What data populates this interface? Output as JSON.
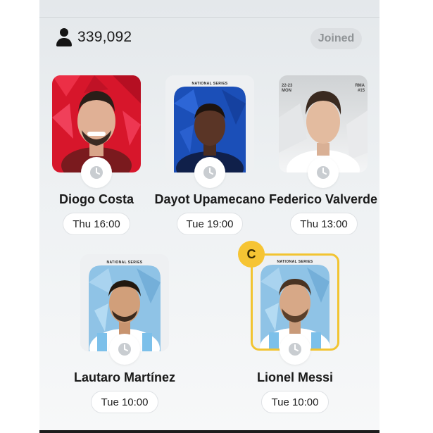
{
  "league": {
    "participant_count": "339,092",
    "status_badge": "Joined"
  },
  "cards": [
    {
      "name": "Diogo Costa",
      "time": "Thu 16:00",
      "series_label": "",
      "corner_left": "",
      "corner_right": ""
    },
    {
      "name": "Dayot Upamecano",
      "time": "Tue 19:00",
      "series_label": "NATIONAL SERIES",
      "corner_left": "",
      "corner_right": ""
    },
    {
      "name": "Federico Valverde",
      "time": "Thu 13:00",
      "series_label": "",
      "corner_left": "22-23 MON",
      "corner_right": "RMA #15"
    },
    {
      "name": "Lautaro Martínez",
      "time": "Tue 10:00",
      "series_label": "NATIONAL SERIES",
      "corner_left": "",
      "corner_right": ""
    },
    {
      "name": "Lionel Messi",
      "time": "Tue 10:00",
      "series_label": "NATIONAL SERIES",
      "corner_left": "",
      "corner_right": "",
      "captain": "C"
    }
  ],
  "icons": {
    "participants": "person-icon",
    "lineup_status": "clock-icon"
  },
  "colors": {
    "captain_badge": "#f6c433",
    "joined_badge_bg": "#dcdfe2",
    "joined_badge_text": "#8f9396"
  }
}
